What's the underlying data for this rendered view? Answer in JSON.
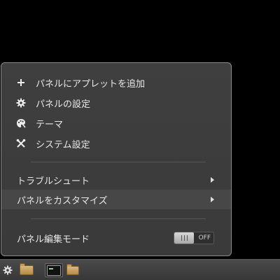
{
  "menu": {
    "items": [
      {
        "label": "パネルにアプレットを追加",
        "icon": "plus-icon"
      },
      {
        "label": "パネルの設定",
        "icon": "gear-icon"
      },
      {
        "label": "テーマ",
        "icon": "palette-icon"
      },
      {
        "label": "システム設定",
        "icon": "tools-icon"
      }
    ],
    "submenus": [
      {
        "label": "トラブルシュート",
        "icon": "chevron-right-icon"
      },
      {
        "label": "パネルをカスタマイズ",
        "icon": "chevron-right-icon"
      }
    ],
    "edit_mode": {
      "label": "パネル編集モード",
      "state": "OFF"
    }
  },
  "taskbar": {
    "icons": [
      "gear-icon",
      "folder-icon",
      "terminal-icon",
      "folder-icon"
    ]
  }
}
